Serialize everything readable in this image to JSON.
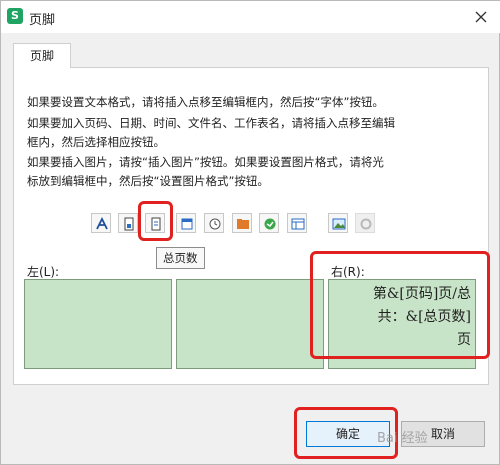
{
  "window": {
    "title": "页脚",
    "app_icon": "S"
  },
  "tabs": [
    {
      "label": "页脚"
    }
  ],
  "help": {
    "line1": "如果要设置文本格式，请将插入点移至编辑框内，然后按“字体”按钮。",
    "line2a": "如果要加入页码、日期、时间、文件名、工作表名，请将插入点移至编辑",
    "line2b": "框内，然后选择相应按钮。",
    "line3a": "如果要插入图片，请按“插入图片”按钮。如果要设置图片格式，请将光",
    "line3b": "标放到编辑框中，然后按“设置图片格式”按钮。"
  },
  "toolbar": {
    "buttons": [
      "font-icon",
      "page-number-icon",
      "total-pages-icon",
      "date-icon",
      "time-icon",
      "file-path-icon",
      "file-name-icon",
      "sheet-name-icon",
      "insert-picture-icon",
      "format-picture-icon"
    ],
    "tooltip": "总页数"
  },
  "sections": {
    "left": "左(L):",
    "center": "",
    "right": "右(R):"
  },
  "right_content": {
    "line1": "第&[页码]页/总",
    "line2": "共：&[总页数]",
    "line3": "页"
  },
  "buttons": {
    "ok": "确定",
    "cancel": "取消"
  },
  "watermark": "Bai 经验",
  "colors": {
    "highlight": "#e0211f",
    "editor_bg": "#c8e4c8",
    "app_green": "#1fa463"
  }
}
